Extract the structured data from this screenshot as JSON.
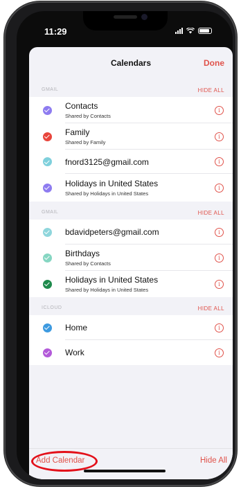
{
  "status": {
    "time": "11:29"
  },
  "nav": {
    "title": "Calendars",
    "done": "Done"
  },
  "sections": [
    {
      "account": "GMAIL",
      "hide_all": "HIDE ALL",
      "items": [
        {
          "title": "Contacts",
          "subtitle": "Shared by Contacts",
          "color": "#8e7cf0"
        },
        {
          "title": "Family",
          "subtitle": "Shared by Family",
          "color": "#e8453c"
        },
        {
          "title": "fnord3125@gmail.com",
          "subtitle": "",
          "color": "#7fd0dc"
        },
        {
          "title": "Holidays in United States",
          "subtitle": "Shared by Holidays in United States",
          "color": "#8e7cf0"
        }
      ]
    },
    {
      "account": "GMAIL",
      "hide_all": "HIDE ALL",
      "items": [
        {
          "title": "bdavidpeters@gmail.com",
          "subtitle": "",
          "color": "#8fd6dc"
        },
        {
          "title": "Birthdays",
          "subtitle": "Shared by Contacts",
          "color": "#86d6c2"
        },
        {
          "title": "Holidays in United States",
          "subtitle": "Shared by Holidays in United States",
          "color": "#1e8a4c"
        }
      ]
    },
    {
      "account": "ICLOUD",
      "hide_all": "HIDE ALL",
      "items": [
        {
          "title": "Home",
          "subtitle": "",
          "color": "#3d9ae0"
        },
        {
          "title": "Work",
          "subtitle": "",
          "color": "#b35ad9"
        }
      ]
    }
  ],
  "bottom": {
    "add_calendar": "Add Calendar",
    "hide_all": "Hide All"
  },
  "icons": {
    "info": "info-icon",
    "check": "checkmark-icon"
  },
  "colors": {
    "accent": "#e0524a",
    "annotation": "#e3101a"
  }
}
